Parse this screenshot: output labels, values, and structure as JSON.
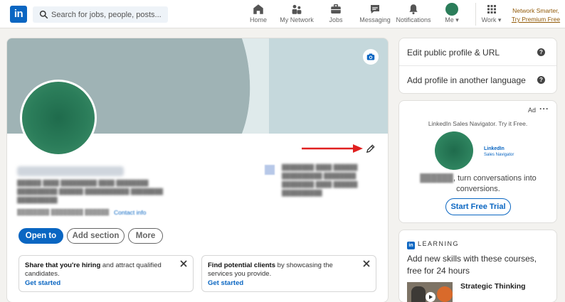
{
  "nav": {
    "logo": "in",
    "search_placeholder": "Search for jobs, people, posts...",
    "items": [
      {
        "label": "Home",
        "icon": "home-icon"
      },
      {
        "label": "My Network",
        "icon": "network-icon"
      },
      {
        "label": "Jobs",
        "icon": "briefcase-icon"
      },
      {
        "label": "Messaging",
        "icon": "chat-icon"
      },
      {
        "label": "Notifications",
        "icon": "bell-icon"
      },
      {
        "label": "Me",
        "icon": "avatar-icon"
      },
      {
        "label": "Work",
        "icon": "grid-icon"
      }
    ],
    "premium_line1": "Network Smarter,",
    "premium_line2": "Try Premium Free"
  },
  "profile": {
    "contact_info": "Contact info",
    "buttons": {
      "open_to": "Open to",
      "add_section": "Add section",
      "more": "More"
    },
    "cards": [
      {
        "bold": "Share that you're hiring",
        "rest": " and attract qualified candidates.",
        "cta": "Get started"
      },
      {
        "bold": "Find potential clients",
        "rest": " by showcasing the services you provide.",
        "cta": "Get started"
      }
    ]
  },
  "sidebar": {
    "edit_profile": "Edit public profile & URL",
    "add_language": "Add profile in another language",
    "ad": {
      "label": "Ad",
      "tagline": "LinkedIn Sales Navigator. Try it Free.",
      "logo_name": "LinkedIn",
      "logo_sub": "Sales Navigator",
      "text_line1": "turn conversations into",
      "text_line2": "conversions.",
      "cta": "Start Free Trial"
    },
    "learning": {
      "header": "LEARNING",
      "logo": "in",
      "text": "Add new skills with these courses, free for 24 hours",
      "course": "Strategic Thinking"
    }
  },
  "colors": {
    "brand": "#0a66c2",
    "premium": "#915907",
    "arrow": "#e02020",
    "banner": "#c5d8dc"
  }
}
